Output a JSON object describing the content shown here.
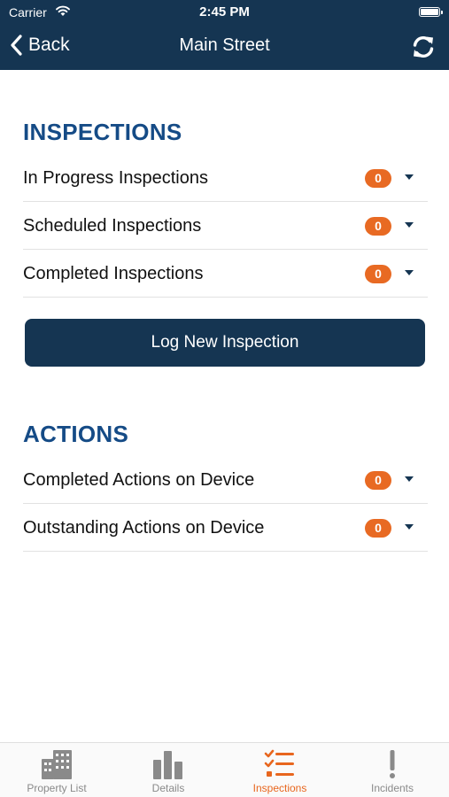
{
  "status_bar": {
    "carrier": "Carrier",
    "time": "2:45 PM"
  },
  "nav": {
    "back_label": "Back",
    "title": "Main Street",
    "refresh_icon": "refresh-icon"
  },
  "inspections": {
    "title": "INSPECTIONS",
    "rows": [
      {
        "label": "In Progress Inspections",
        "count": "0"
      },
      {
        "label": "Scheduled Inspections",
        "count": "0"
      },
      {
        "label": "Completed Inspections",
        "count": "0"
      }
    ],
    "log_button": "Log New Inspection"
  },
  "actions": {
    "title": "ACTIONS",
    "rows": [
      {
        "label": "Completed Actions on Device",
        "count": "0"
      },
      {
        "label": "Outstanding Actions on Device",
        "count": "0"
      }
    ]
  },
  "tabs": [
    {
      "label": "Property List",
      "icon": "building-icon",
      "active": false
    },
    {
      "label": "Details",
      "icon": "bar-chart-icon",
      "active": false
    },
    {
      "label": "Inspections",
      "icon": "checklist-icon",
      "active": true
    },
    {
      "label": "Incidents",
      "icon": "exclamation-icon",
      "active": false
    }
  ],
  "colors": {
    "header": "#153552",
    "section_title": "#154b86",
    "badge": "#e86a23",
    "active_tab": "#e8661e",
    "inactive_tab": "#8a8a8a"
  }
}
